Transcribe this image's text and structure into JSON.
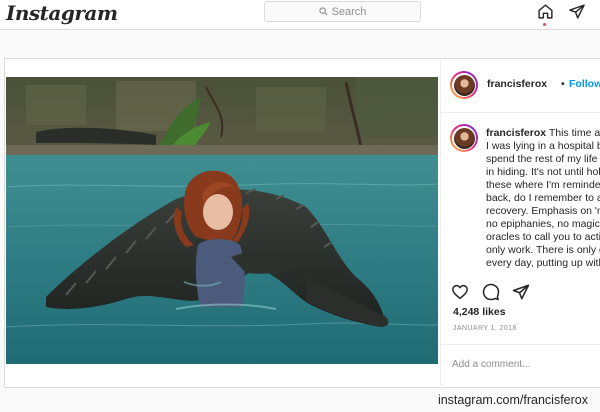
{
  "topbar": {
    "logo": "Instagram",
    "search_placeholder": "Search",
    "home_icon": "home-icon",
    "direct_icon": "paper-plane-icon",
    "notification_color": "#ed4956"
  },
  "post": {
    "username": "francisferox",
    "follow_separator": "•",
    "follow_label": "Follow",
    "follow_color": "#0095f6",
    "caption_lines": [
      "This time a fe",
      "I was lying in a hospital be",
      "spend the rest of my life c",
      "in hiding. It's not until hol",
      "these where I'm reminded",
      "back, do I remember to ap",
      "recovery. Emphasis on 'm",
      "no epiphanies, no magic c",
      "oracles to call you to actio",
      "only work. There is only g",
      "every day, putting up with"
    ],
    "likes": "4,248 likes",
    "date": "JANUARY 1, 2018",
    "comment_placeholder": "Add a comment..."
  },
  "credit": "instagram.com/francisferox"
}
